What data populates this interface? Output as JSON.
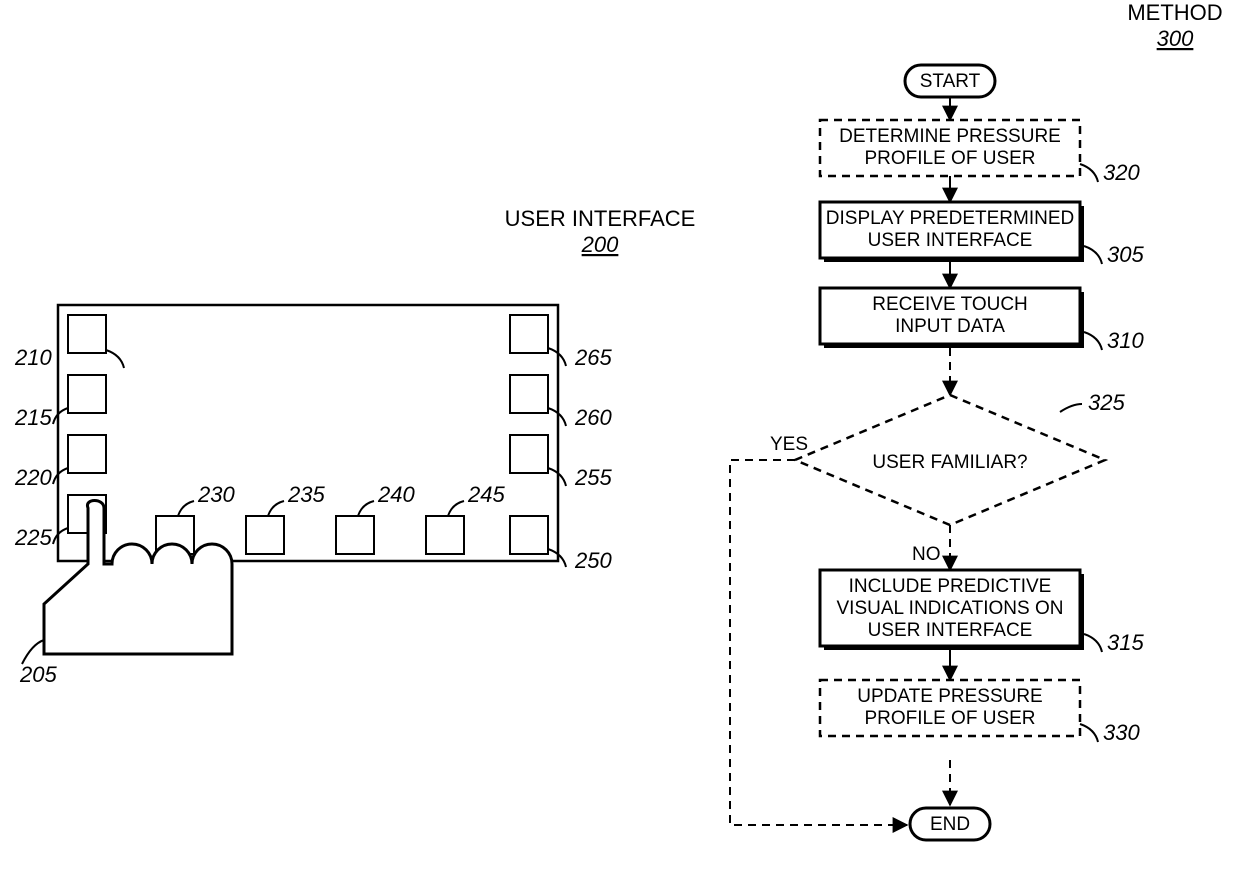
{
  "left": {
    "title": "USER INTERFACE",
    "title_ref": "200",
    "refs": {
      "hand": "205",
      "b210": "210",
      "b215": "215",
      "b220": "220",
      "b225": "225",
      "b230": "230",
      "b235": "235",
      "b240": "240",
      "b245": "245",
      "b250": "250",
      "b255": "255",
      "b260": "260",
      "b265": "265"
    }
  },
  "right": {
    "title": "METHOD",
    "title_ref": "300",
    "start": "START",
    "end": "END",
    "yes": "YES",
    "no": "NO",
    "steps": {
      "s320": {
        "text": "DETERMINE PRESSURE PROFILE OF USER",
        "ref": "320"
      },
      "s305": {
        "text": "DISPLAY PREDETERMINED USER INTERFACE",
        "ref": "305"
      },
      "s310": {
        "text": "RECEIVE TOUCH INPUT DATA",
        "ref": "310"
      },
      "s325": {
        "text": "USER FAMILIAR?",
        "ref": "325"
      },
      "s315": {
        "text": "INCLUDE PREDICTIVE VISUAL INDICATIONS ON USER INTERFACE",
        "ref": "315"
      },
      "s330": {
        "text": "UPDATE PRESSURE PROFILE OF USER",
        "ref": "330"
      }
    }
  }
}
